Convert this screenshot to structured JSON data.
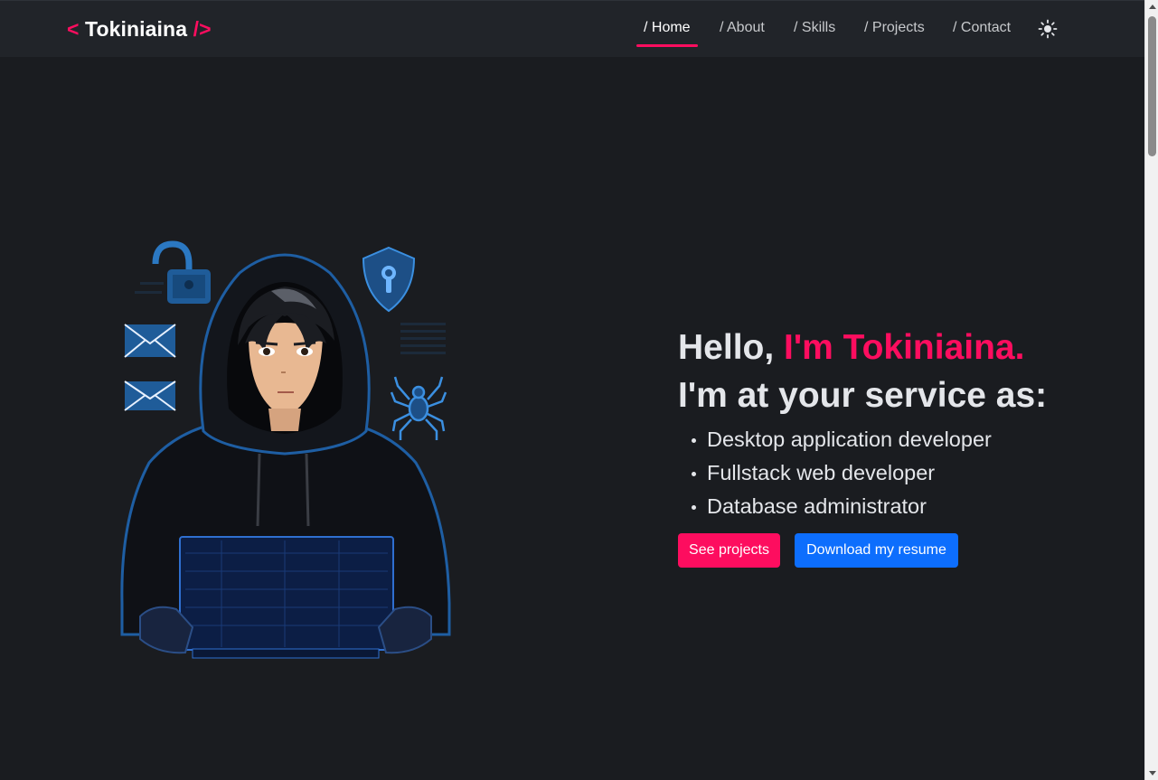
{
  "navbar": {
    "brand": {
      "open": "<",
      "name": "Tokiniaina",
      "close": "/>"
    },
    "links": [
      {
        "label": "/ Home",
        "active": true
      },
      {
        "label": "/ About",
        "active": false
      },
      {
        "label": "/ Skills",
        "active": false
      },
      {
        "label": "/ Projects",
        "active": false
      },
      {
        "label": "/ Contact",
        "active": false
      }
    ],
    "theme_toggle_icon": "sun-icon"
  },
  "hero": {
    "greeting_prefix": "Hello, ",
    "greeting_name": "I'm Tokiniaina.",
    "service_line": "I'm at your service as:",
    "roles": [
      "Desktop application developer",
      "Fullstack web developer",
      "Database administrator"
    ],
    "buttons": {
      "projects": "See projects",
      "resume": "Download my resume"
    },
    "illustration_icons": [
      "unlocked-padlock-icon",
      "shield-keyhole-icon",
      "envelope-icon",
      "envelope-icon",
      "spider-icon",
      "hooded-developer-laptop"
    ]
  },
  "colors": {
    "accent": "#fd0d5f",
    "primary_button": "#0d6efd",
    "background": "#1a1c20",
    "navbar": "#212429",
    "text": "#e4e6ea"
  }
}
